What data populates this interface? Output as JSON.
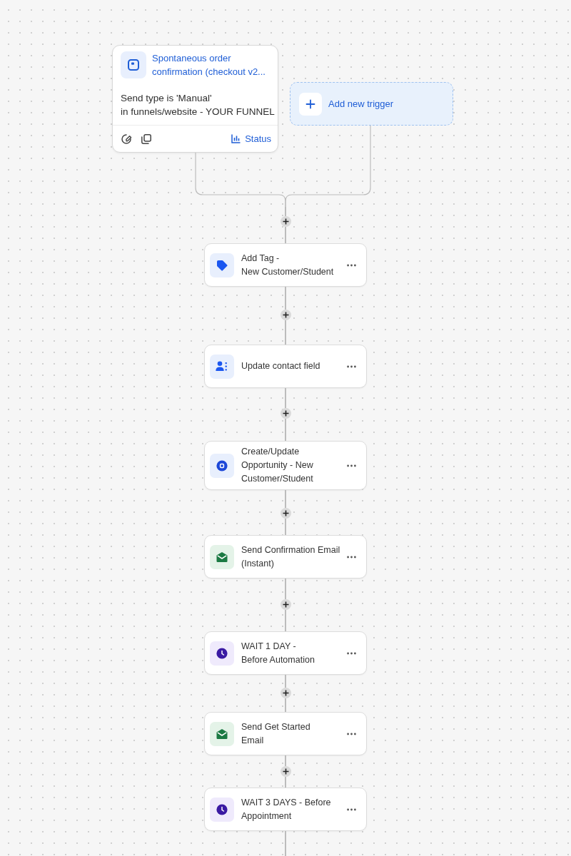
{
  "trigger": {
    "title": [
      "Spontaneous order",
      "confirmation (checkout v2..."
    ],
    "conditions": [
      "Send type is 'Manual'",
      "in funnels/website - YOUR FUNNEL"
    ],
    "status_label": "Status"
  },
  "add_trigger": {
    "label": "Add new trigger"
  },
  "actions": [
    {
      "kind": "tag",
      "title": [
        "Add Tag -",
        "New Customer/Student"
      ]
    },
    {
      "kind": "contact",
      "title": [
        "Update contact field"
      ]
    },
    {
      "kind": "opportunity",
      "title": [
        "Create/Update",
        "Opportunity - New",
        "Customer/Student"
      ]
    },
    {
      "kind": "email",
      "title": [
        "Send Confirmation Email",
        "(Instant)"
      ]
    },
    {
      "kind": "wait",
      "title": [
        "WAIT 1 DAY -",
        "Before Automation"
      ]
    },
    {
      "kind": "email",
      "title": [
        "Send Get Started",
        "Email"
      ]
    },
    {
      "kind": "wait",
      "title": [
        "WAIT 3 DAYS - Before",
        "Appointment"
      ]
    }
  ]
}
